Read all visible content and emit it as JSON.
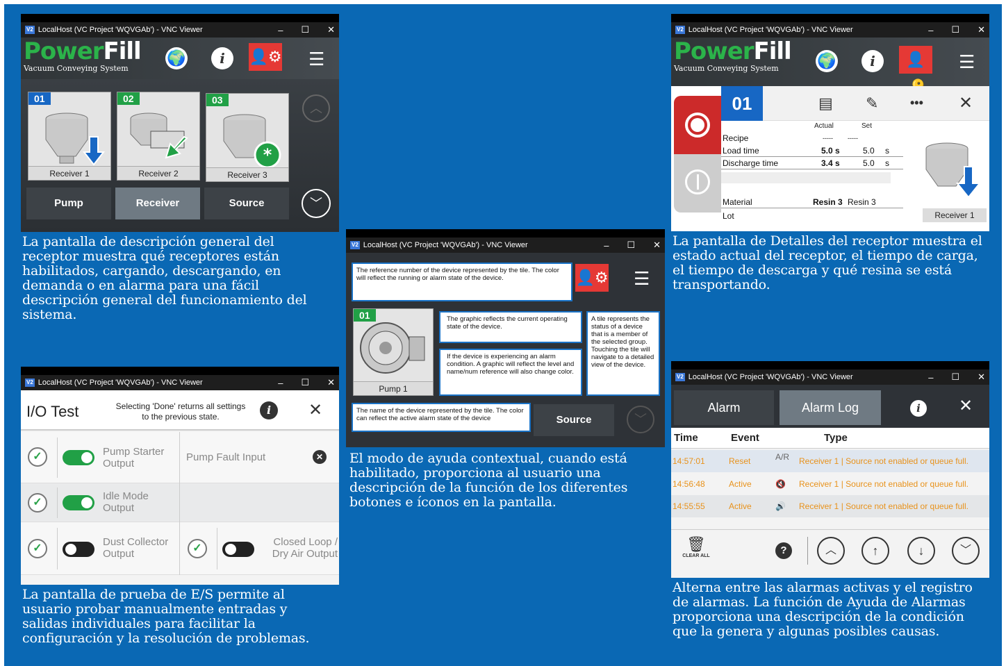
{
  "window_title": "LocalHost (VC Project 'WQVGAb') - VNC Viewer",
  "window_logo": "V2",
  "window_controls": {
    "minimize": "–",
    "maximize": "☐",
    "close": "✕"
  },
  "brand": {
    "power": "Power",
    "fill": "Fill",
    "subtitle": "Vacuum Conveying System"
  },
  "overview": {
    "tiles": [
      {
        "num": "01",
        "label": "Receiver 1",
        "num_color": "#1767c4"
      },
      {
        "num": "02",
        "label": "Receiver 2",
        "num_color": "#21a046"
      },
      {
        "num": "03",
        "label": "Receiver 3",
        "num_color": "#21a046"
      }
    ],
    "tabs": [
      {
        "label": "Pump"
      },
      {
        "label": "Receiver"
      },
      {
        "label": "Source"
      }
    ],
    "caption": "La pantalla de descripción general del receptor muestra qué receptores están habilitados, cargando, descargando, en demanda o en alarma para una fácil descripción general del funcionamiento del sistema."
  },
  "details": {
    "id": "01",
    "col_actual": "Actual",
    "col_set": "Set",
    "rows": [
      {
        "label": "Recipe",
        "actual": "-----",
        "set": "-----",
        "unit": ""
      },
      {
        "label": "Load time",
        "actual": "5.0 s",
        "set": "5.0",
        "unit": "s"
      },
      {
        "label": "Discharge time",
        "actual": "3.4 s",
        "set": "5.0",
        "unit": "s"
      }
    ],
    "material_label": "Material",
    "material_actual": "Resin 3",
    "material_set": "Resin 3",
    "lot_label": "Lot",
    "receiver_label": "Receiver 1",
    "more": "•••",
    "caption": "La pantalla de Detalles del receptor muestra el estado actual del receptor, el tiempo de carga, el tiempo de descarga y qué resina se está transportando."
  },
  "help": {
    "tile_num": "01",
    "tile_label": "Pump 1",
    "source_label": "Source",
    "tips": [
      "The reference number of the device represented by the tile. The color will reflect the running or alarm state of the device.",
      "The graphic reflects the current operating state of the device.",
      "If the device is experiencing an alarm condition. A graphic will reflect the level and name/num reference will also change color.",
      "A tile represents the status of a device that is a member of the selected group. Touching the tile will navigate to a detailed view of the device.",
      "The name of the device represented by the tile. The color can reflect the active alarm state of the device"
    ],
    "caption": "El modo de ayuda contextual, cuando está habilitado, proporciona al usuario una descripción de la función de los diferentes botones e íconos en la pantalla."
  },
  "iotest": {
    "title_io": "I/O",
    "title_test": "Test",
    "notice": "Selecting 'Done' returns all settings to the previous state.",
    "rows": [
      {
        "left": "Pump Starter Output",
        "right": "Pump Fault Input",
        "on": true
      },
      {
        "left": "Idle Mode Output",
        "right": "",
        "on": true
      },
      {
        "left": "Dust Collector Output",
        "right": "Closed Loop / Dry Air Output",
        "on": false
      }
    ],
    "caption": "La pantalla de prueba de E/S permite al usuario probar manualmente entradas y salidas individuales para facilitar la configuración y la resolución de problemas."
  },
  "alarm": {
    "tabs": [
      {
        "label": "Alarm"
      },
      {
        "label": "Alarm Log"
      }
    ],
    "headers": {
      "time": "Time",
      "event": "Event",
      "type": "Type"
    },
    "rows": [
      {
        "time": "14:57:01",
        "event": "Reset",
        "icon": "A/R",
        "type": "Receiver 1 | Source not enabled or queue full."
      },
      {
        "time": "14:56:48",
        "event": "Active",
        "icon": "🔇",
        "type": "Receiver 1 | Source not enabled or queue full."
      },
      {
        "time": "14:55:55",
        "event": "Active",
        "icon": "🔊",
        "type": "Receiver 1 | Source not enabled or queue full."
      }
    ],
    "clear_all": "CLEAR ALL",
    "caption": "Alterna entre las alarmas activas y el registro de alarmas. La función de Ayuda de Alarmas proporciona una descripción de la condición que la genera y algunas posibles causas."
  },
  "colors": {
    "background": "#0a68b4",
    "green": "#2bb34a",
    "red": "#e53935",
    "blue": "#1767c4",
    "alarm_text": "#e8921b"
  }
}
